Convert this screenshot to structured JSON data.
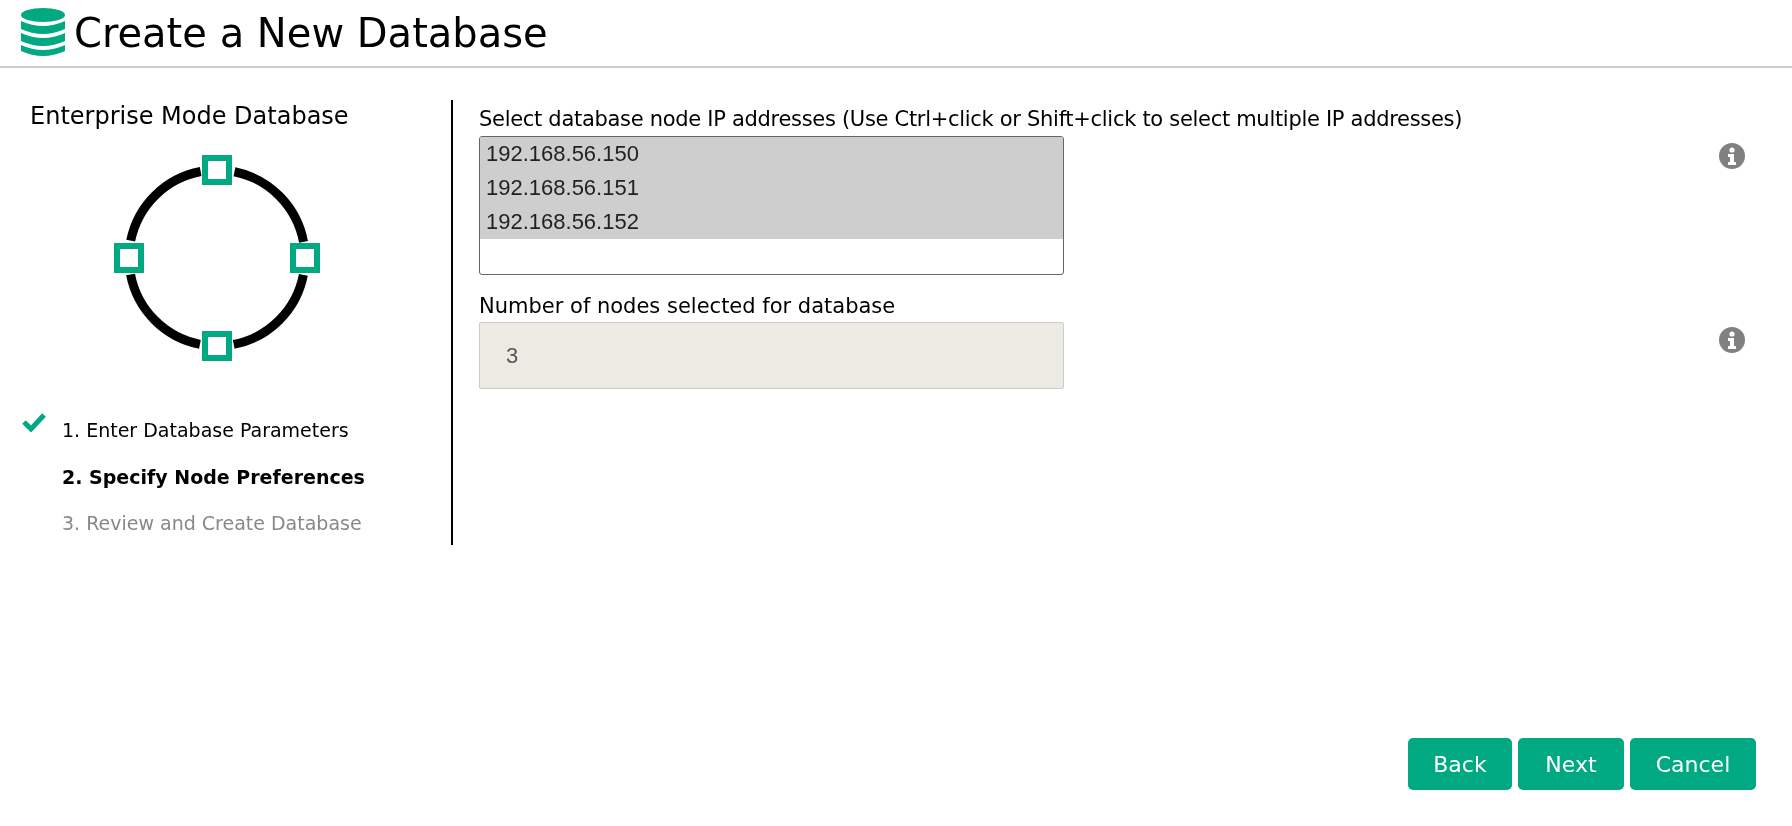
{
  "header": {
    "title": "Create a New Database"
  },
  "sidebar": {
    "title": "Enterprise Mode Database",
    "steps": [
      {
        "label": "1. Enter Database Parameters",
        "completed": true,
        "selected": false
      },
      {
        "label": "2. Specify Node Preferences",
        "completed": false,
        "selected": true
      },
      {
        "label": "3. Review and Create Database",
        "completed": false,
        "selected": false
      }
    ]
  },
  "form": {
    "ip_label": "Select database node IP addresses (Use Ctrl+click or Shift+click to select multiple IP addresses)",
    "ip_options": [
      {
        "label": "192.168.56.150",
        "selected": true
      },
      {
        "label": "192.168.56.151",
        "selected": true
      },
      {
        "label": "192.168.56.152",
        "selected": true
      }
    ],
    "count_label": "Number of nodes selected for database",
    "count_value": "3",
    "count_disabled": true
  },
  "buttons": [
    {
      "label": "Back"
    },
    {
      "label": "Next"
    },
    {
      "label": "Cancel"
    }
  ]
}
